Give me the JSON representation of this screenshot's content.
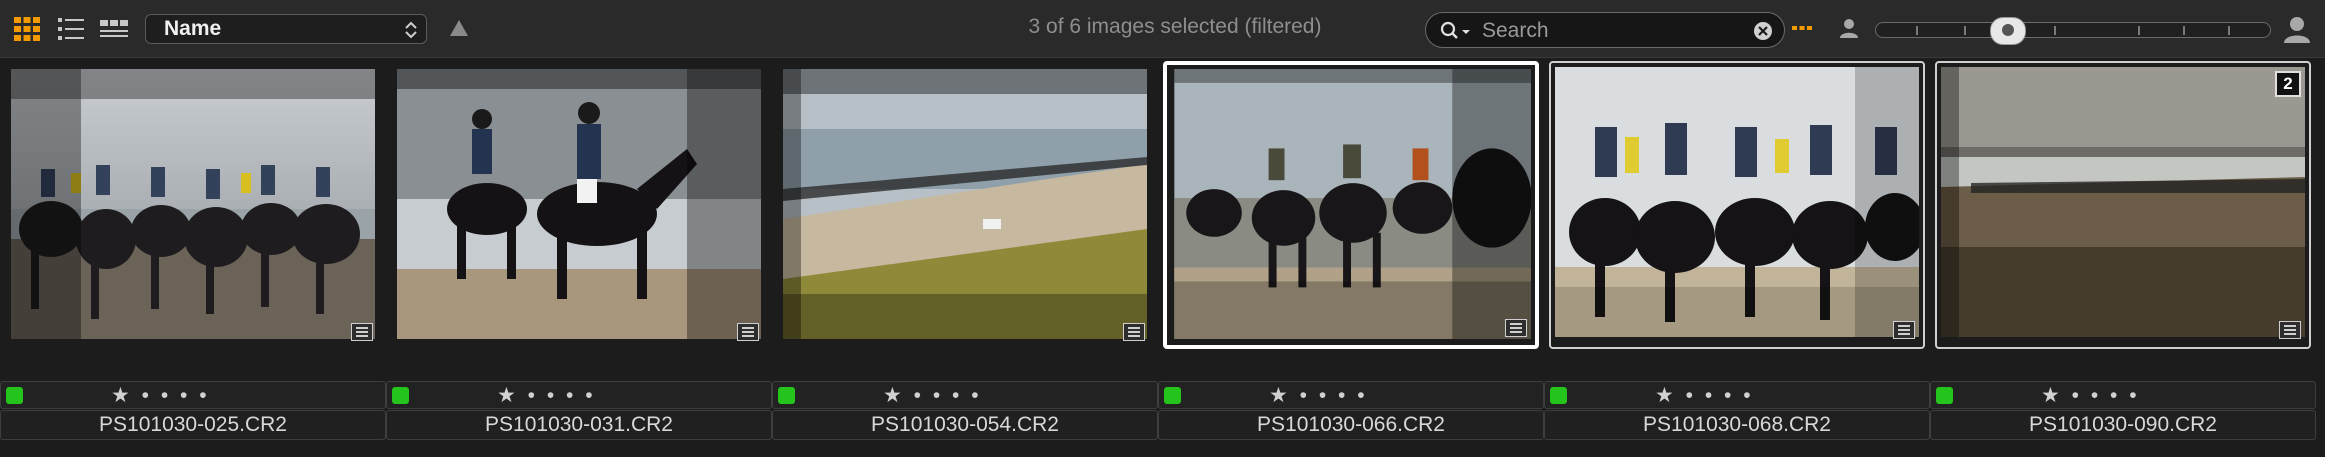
{
  "toolbar": {
    "view_icons": [
      "grid-view-icon",
      "list-view-icon",
      "filmstrip-view-icon"
    ],
    "sort_label": "Name",
    "sort_direction_icon": "triangle-up-icon",
    "status": "3 of 6 images selected (filtered)",
    "search": {
      "placeholder": "Search",
      "value": ""
    },
    "more_icon": "ellipsis-icon",
    "zoom_level": 0.33,
    "accent_color": "#f29a00"
  },
  "thumbnails": [
    {
      "filename": "PS101030-025.CR2",
      "rating": "★ • • • •",
      "label_color": "#25c41c",
      "selected": false
    },
    {
      "filename": "PS101030-031.CR2",
      "rating": "★ • • • •",
      "label_color": "#25c41c",
      "selected": false
    },
    {
      "filename": "PS101030-054.CR2",
      "rating": "★ • • • •",
      "label_color": "#25c41c",
      "selected": false
    },
    {
      "filename": "PS101030-066.CR2",
      "rating": "★ • • • •",
      "label_color": "#25c41c",
      "selected": true
    },
    {
      "filename": "PS101030-068.CR2",
      "rating": "★ • • • •",
      "label_color": "#25c41c",
      "selected": true
    },
    {
      "filename": "PS101030-090.CR2",
      "rating": "★ • • • •",
      "label_color": "#25c41c",
      "selected": true,
      "stack_count": "2"
    }
  ]
}
